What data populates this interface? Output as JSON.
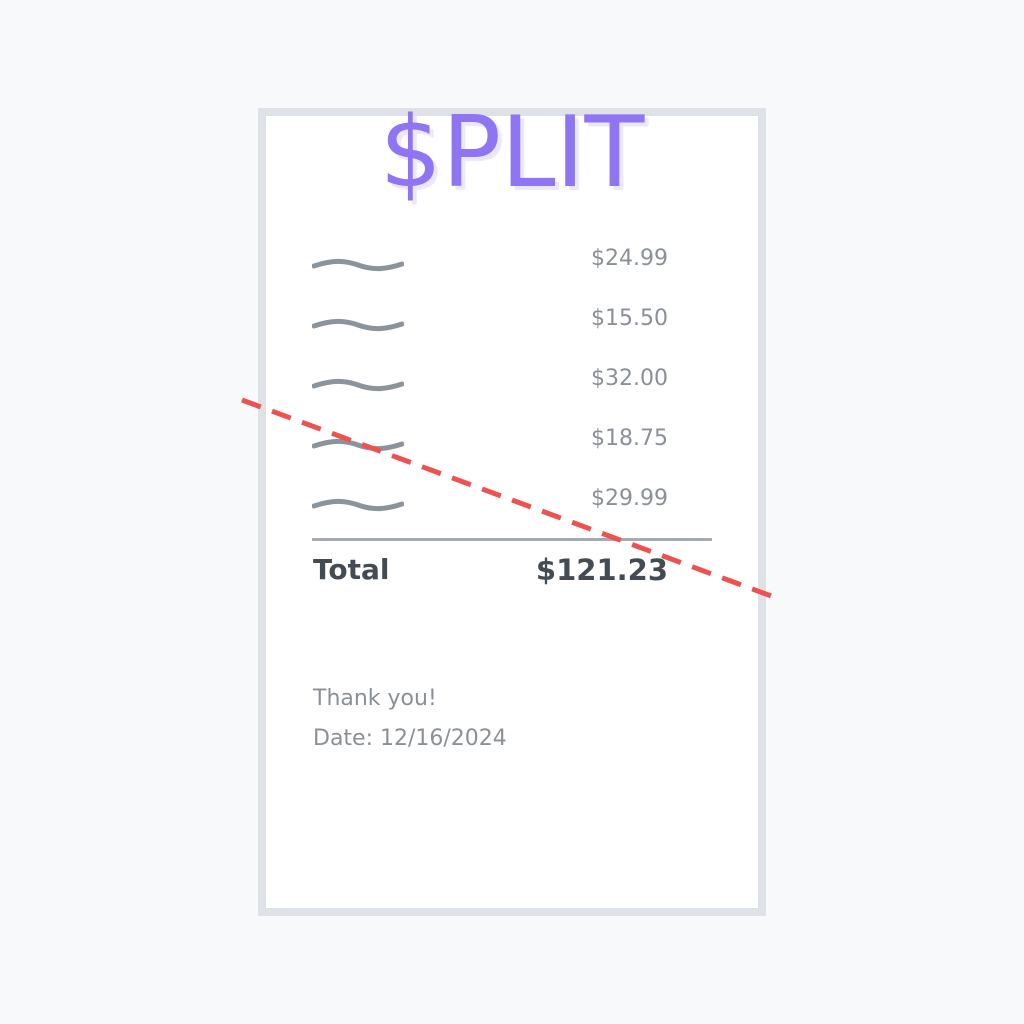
{
  "receipt": {
    "logo": "$PLIT",
    "items": [
      {
        "price": "$24.99"
      },
      {
        "price": "$15.50"
      },
      {
        "price": "$32.00"
      },
      {
        "price": "$18.75"
      },
      {
        "price": "$29.99"
      }
    ],
    "total_label": "Total",
    "total_value": "$121.23",
    "thanks": "Thank you!",
    "date": "Date: 12/16/2024"
  },
  "icons": {
    "item_placeholder": "squiggle-line-icon",
    "cut": "dashed-cut-line-icon"
  },
  "colors": {
    "logo": "#8f74f3",
    "cut_line": "#ee5250",
    "text_muted": "#8b9098",
    "text_strong": "#454b53",
    "receipt_border": "#dee1e6"
  }
}
